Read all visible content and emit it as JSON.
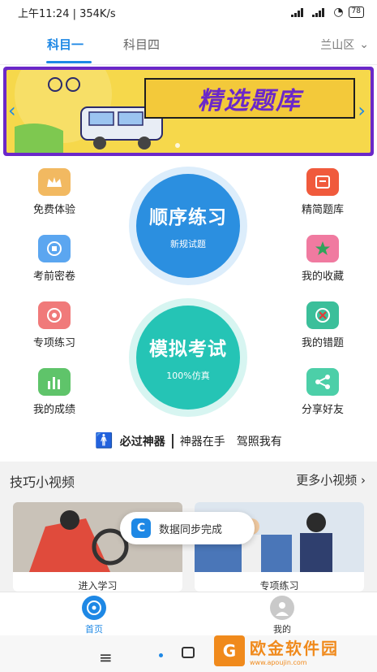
{
  "status_bar": {
    "time_speed": "上午11:24 | 354K/s",
    "battery": "78"
  },
  "tabs": [
    {
      "label": "科目一"
    },
    {
      "label": "科目四"
    }
  ],
  "region": {
    "label": "兰山区"
  },
  "banner": {
    "title": "精选题库"
  },
  "features": {
    "free_trial": "免费体验",
    "premium_bank": "精简题库",
    "exam_secret": "考前密卷",
    "my_favorites": "我的收藏",
    "special_practice": "专项练习",
    "my_mistakes": "我的错题",
    "my_scores": "我的成绩",
    "share_friends": "分享好友"
  },
  "big_buttons": {
    "sequential": {
      "main": "顺序练习",
      "sub": "新规试题"
    },
    "mock_exam": {
      "main": "模拟考试",
      "sub": "100%仿真"
    }
  },
  "slogan": {
    "brand": "必过神器",
    "tagline": "神器在手　驾照我有"
  },
  "videos": {
    "title": "技巧小视频",
    "more": "更多小视频",
    "cards": [
      {
        "caption": "进入学习"
      },
      {
        "caption": "专项练习"
      }
    ]
  },
  "toast": {
    "text": "数据同步完成"
  },
  "bottom_nav": [
    {
      "label": "首页"
    },
    {
      "label": "我的"
    }
  ],
  "watermark": {
    "text": "欧金软件园",
    "url": "www.apoujin.com"
  },
  "colors": {
    "accent": "#1e88e5",
    "teal": "#26c6b9",
    "banner_border": "#6b28c9",
    "watermark": "#f08a1c"
  }
}
